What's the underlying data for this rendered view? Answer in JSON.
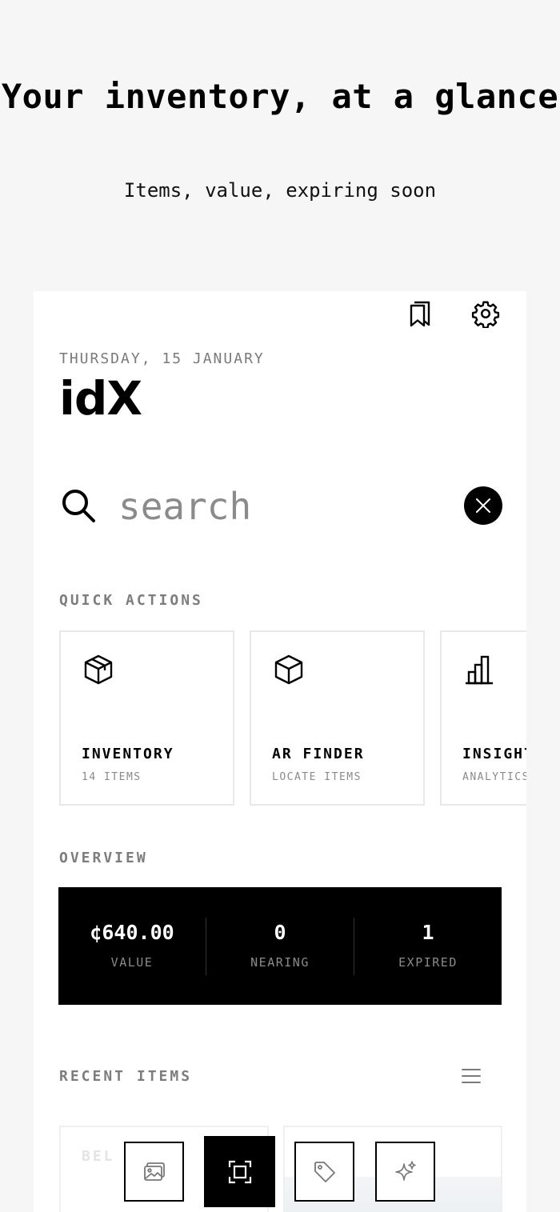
{
  "hero": {
    "title": "Your inventory, at a glance",
    "subtitle": "Items, value, expiring soon"
  },
  "header": {
    "date": "THURSDAY, 15 JANUARY",
    "logo": "idX"
  },
  "search": {
    "placeholder": "search",
    "value": ""
  },
  "quick_actions": {
    "label": "QUICK ACTIONS",
    "items": [
      {
        "title": "INVENTORY",
        "subtitle": "14 ITEMS",
        "icon": "package-icon"
      },
      {
        "title": "AR FINDER",
        "subtitle": "LOCATE ITEMS",
        "icon": "cube-icon"
      },
      {
        "title": "INSIGHTS",
        "subtitle": "ANALYTICS",
        "icon": "bar-chart-icon"
      }
    ]
  },
  "overview": {
    "label": "OVERVIEW",
    "stats": [
      {
        "value": "¢640.00",
        "label": "VALUE"
      },
      {
        "value": "0",
        "label": "NEARING"
      },
      {
        "value": "1",
        "label": "EXPIRED"
      }
    ]
  },
  "recent": {
    "label": "RECENT ITEMS",
    "items": [
      {
        "name": "BEL A"
      }
    ]
  },
  "toolbar": {
    "buttons": [
      "gallery-icon",
      "scan-icon",
      "tag-icon",
      "sparkle-icon"
    ]
  }
}
